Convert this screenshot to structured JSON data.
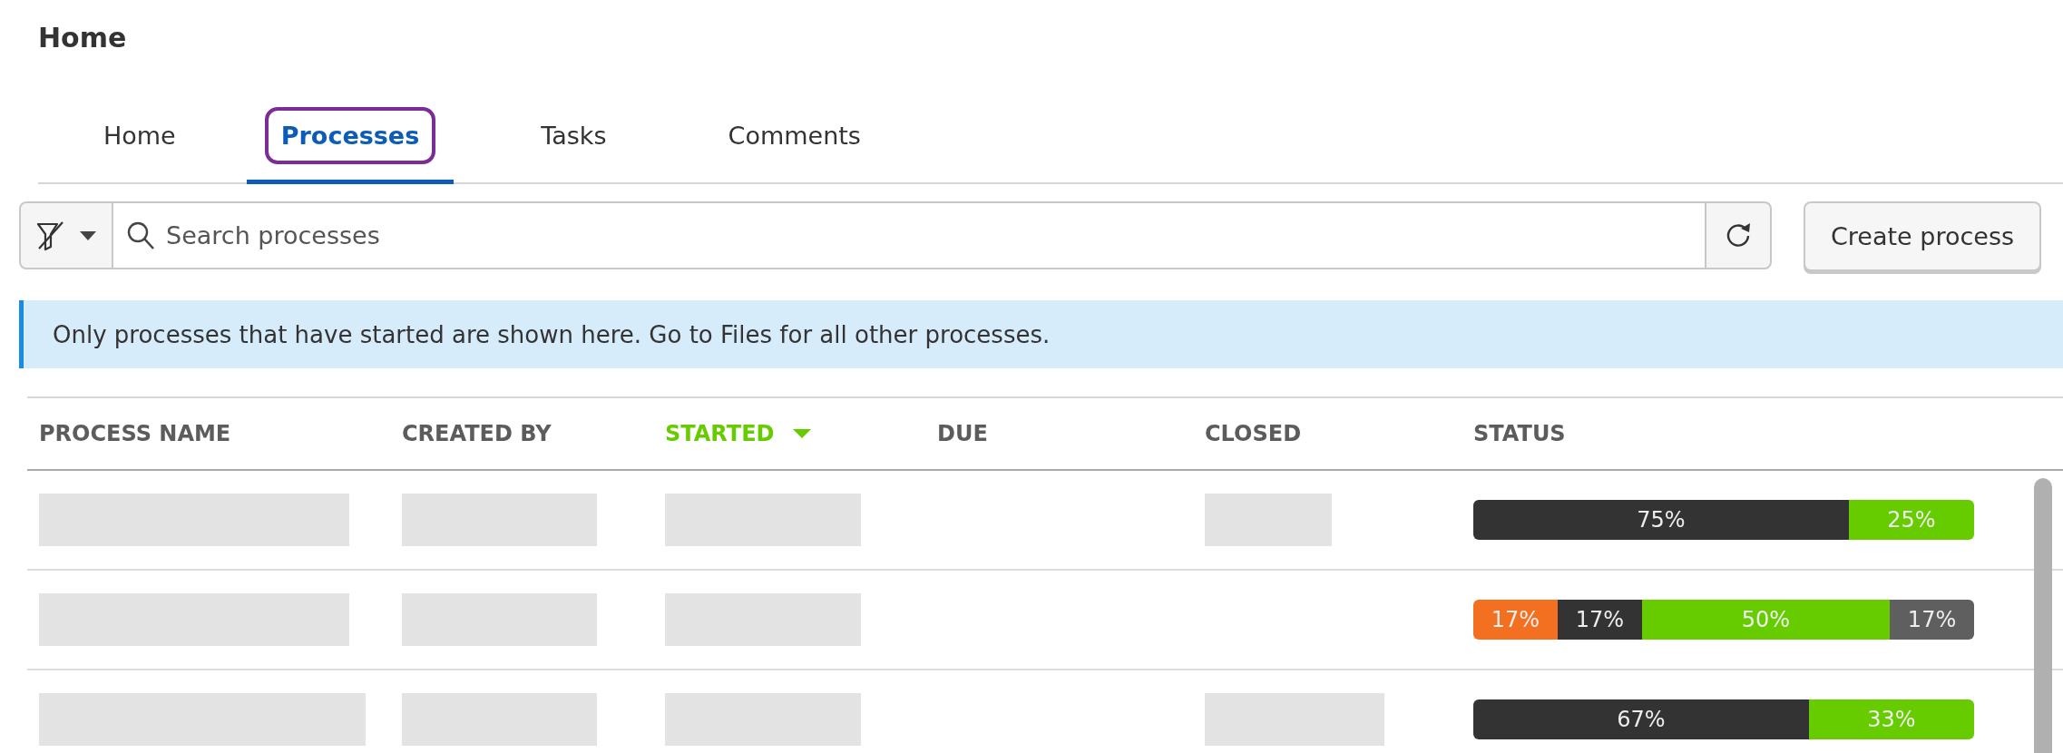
{
  "page": {
    "title": "Home"
  },
  "tabs": [
    {
      "label": "Home",
      "selected": false,
      "focused": false
    },
    {
      "label": "Processes",
      "selected": true,
      "focused": true
    },
    {
      "label": "Tasks",
      "selected": false,
      "focused": false
    },
    {
      "label": "Comments",
      "selected": false,
      "focused": false
    }
  ],
  "search": {
    "placeholder": "Search processes"
  },
  "create_button": "Create process",
  "info_banner": "Only processes that have started are shown here. Go to Files for all other processes.",
  "table": {
    "columns": [
      {
        "label": "PROCESS NAME",
        "sorted": false
      },
      {
        "label": "CREATED BY",
        "sorted": false
      },
      {
        "label": "STARTED",
        "sorted": true
      },
      {
        "label": "DUE",
        "sorted": false
      },
      {
        "label": "CLOSED",
        "sorted": false
      },
      {
        "label": "STATUS",
        "sorted": false
      }
    ],
    "rows": [
      {
        "loading": [
          true,
          true,
          true,
          false,
          true
        ],
        "status": [
          {
            "label": "75%",
            "color": "#333333"
          },
          {
            "label": "25%",
            "color": "#66cc00"
          }
        ]
      },
      {
        "loading": [
          true,
          true,
          true,
          false,
          false
        ],
        "status": [
          {
            "label": "17%",
            "color": "#f37021"
          },
          {
            "label": "17%",
            "color": "#333333"
          },
          {
            "label": "50%",
            "color": "#66cc00"
          },
          {
            "label": "17%",
            "color": "#5f5f5f"
          }
        ]
      },
      {
        "loading": [
          true,
          true,
          true,
          false,
          true
        ],
        "status": [
          {
            "label": "67%",
            "color": "#333333"
          },
          {
            "label": "33%",
            "color": "#66cc00"
          }
        ]
      }
    ]
  }
}
